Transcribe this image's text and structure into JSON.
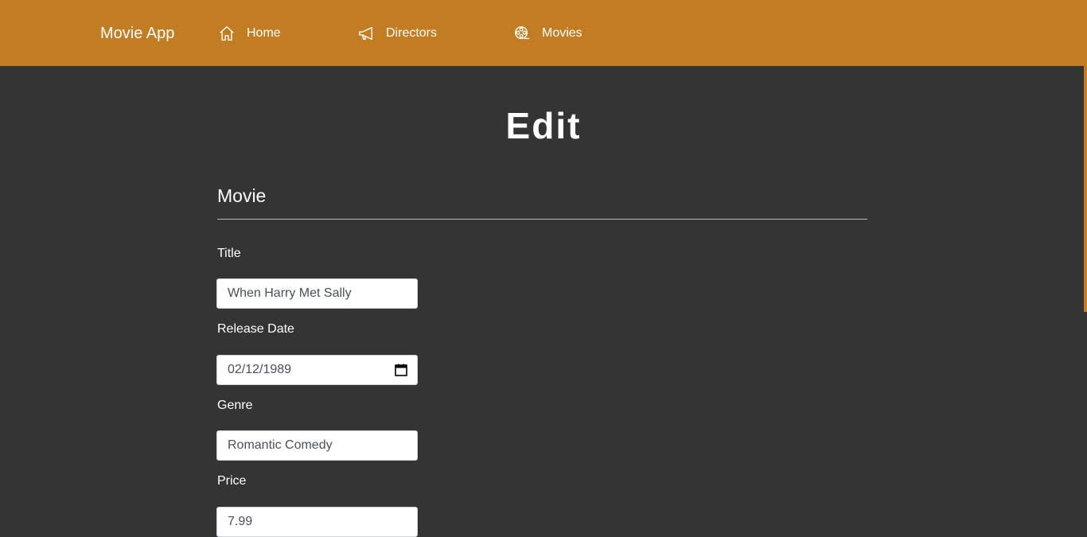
{
  "nav": {
    "brand": "Movie App",
    "items": [
      {
        "label": "Home",
        "icon": "home-icon"
      },
      {
        "label": "Directors",
        "icon": "megaphone-icon"
      },
      {
        "label": "Movies",
        "icon": "film-reel-icon"
      }
    ]
  },
  "page": {
    "title": "Edit",
    "section": "Movie"
  },
  "form": {
    "title": {
      "label": "Title",
      "value": "When Harry Met Sally"
    },
    "release_date": {
      "label": "Release Date",
      "value": "02/12/1989"
    },
    "genre": {
      "label": "Genre",
      "value": "Romantic Comedy"
    },
    "price": {
      "label": "Price",
      "value": "7.99"
    }
  },
  "colors": {
    "navbar": "#c27d22",
    "background": "#343434",
    "text": "#ffffff"
  }
}
